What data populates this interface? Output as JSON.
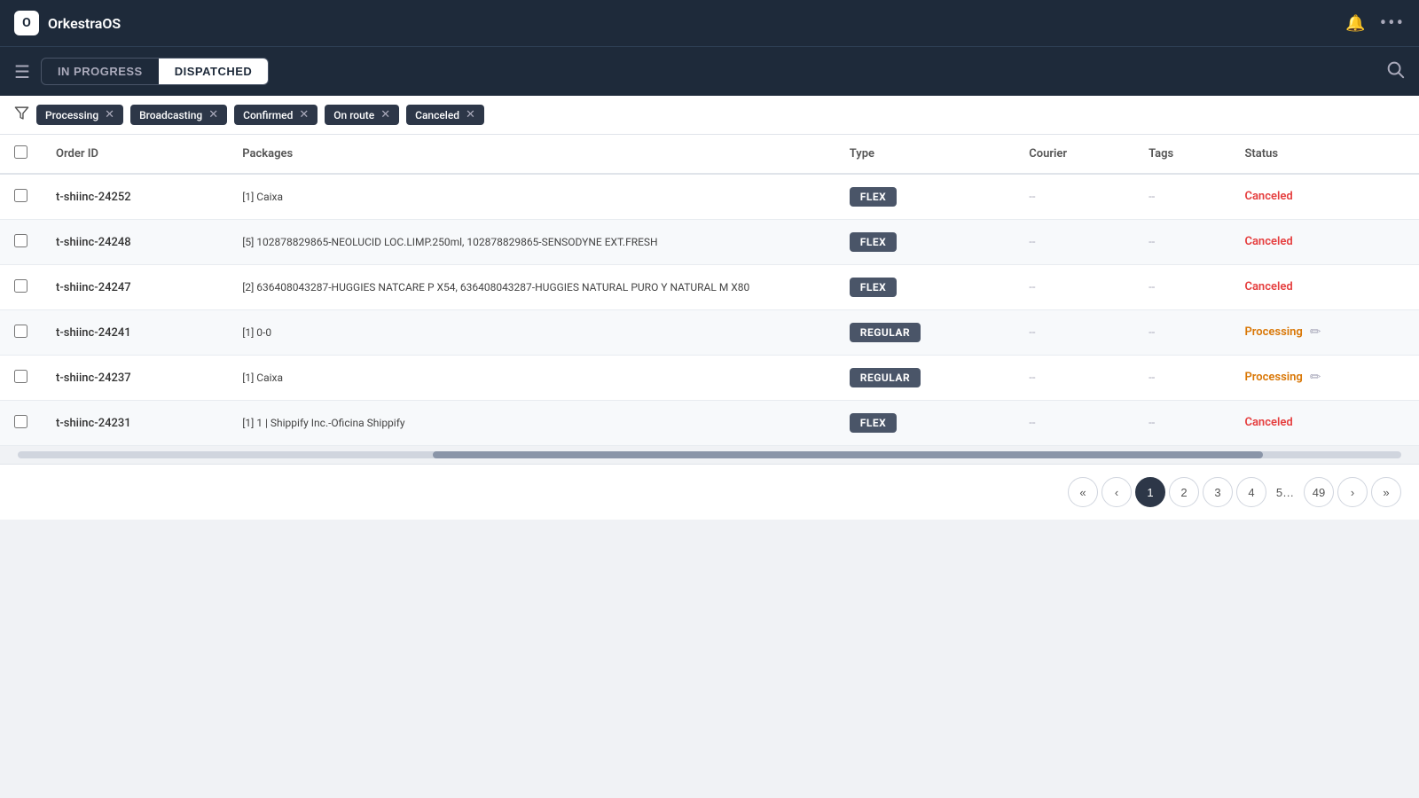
{
  "app": {
    "logo": "O",
    "title": "OrkestraOS"
  },
  "nav": {
    "bell_icon": "🔔",
    "more_icon": "···",
    "search_icon": "🔍"
  },
  "toolbar": {
    "menu_icon": "☰",
    "tabs": [
      {
        "id": "in-progress",
        "label": "IN PROGRESS",
        "active": false
      },
      {
        "id": "dispatched",
        "label": "DISPATCHED",
        "active": true
      }
    ]
  },
  "filter_bar": {
    "filters": [
      {
        "id": "processing",
        "label": "Processing"
      },
      {
        "id": "broadcasting",
        "label": "Broadcasting"
      },
      {
        "id": "confirmed",
        "label": "Confirmed"
      },
      {
        "id": "on-route",
        "label": "On route"
      },
      {
        "id": "canceled",
        "label": "Canceled"
      }
    ]
  },
  "table": {
    "columns": [
      "Order ID",
      "Packages",
      "Type",
      "Courier",
      "Tags",
      "Status"
    ],
    "rows": [
      {
        "id": "t-shiinc-24252",
        "packages": "[1] Caixa",
        "type": "FLEX",
        "courier": "--",
        "tags": "--",
        "status": "Canceled",
        "status_class": "status-canceled",
        "has_edit": false
      },
      {
        "id": "t-shiinc-24248",
        "packages": "[5] 102878829865-NEOLUCID LOC.LIMP.250ml, 102878829865-SENSODYNE EXT.FRESH",
        "type": "FLEX",
        "courier": "--",
        "tags": "--",
        "status": "Canceled",
        "status_class": "status-canceled",
        "has_edit": false
      },
      {
        "id": "t-shiinc-24247",
        "packages": "[2] 636408043287-HUGGIES NATCARE P X54, 636408043287-HUGGIES NATURAL PURO Y NATURAL M X80",
        "type": "FLEX",
        "courier": "--",
        "tags": "--",
        "status": "Canceled",
        "status_class": "status-canceled",
        "has_edit": false
      },
      {
        "id": "t-shiinc-24241",
        "packages": "[1] 0-0",
        "type": "REGULAR",
        "courier": "--",
        "tags": "--",
        "status": "Processing",
        "status_class": "status-processing",
        "has_edit": true
      },
      {
        "id": "t-shiinc-24237",
        "packages": "[1] Caixa",
        "type": "REGULAR",
        "courier": "--",
        "tags": "--",
        "status": "Processing",
        "status_class": "status-processing",
        "has_edit": true
      },
      {
        "id": "t-shiinc-24231",
        "packages": "[1] 1 | Shippify Inc.-Oficina Shippify",
        "type": "FLEX",
        "courier": "--",
        "tags": "--",
        "status": "Canceled",
        "status_class": "status-canceled",
        "has_edit": false
      }
    ]
  },
  "pagination": {
    "pages": [
      "1",
      "2",
      "3",
      "4",
      "5...",
      "49"
    ],
    "current": "1",
    "ellipsis": "..."
  }
}
